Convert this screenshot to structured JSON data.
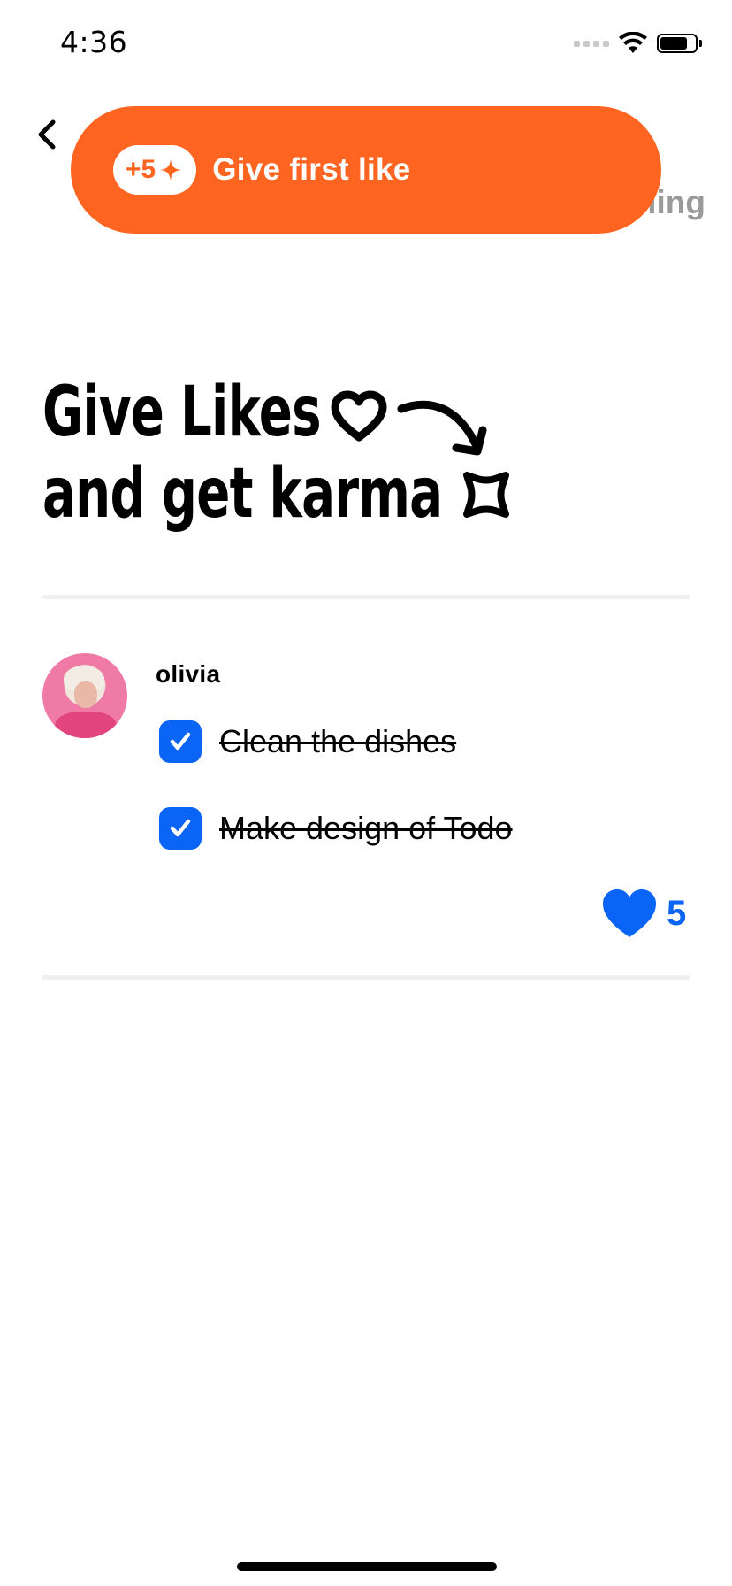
{
  "status_bar": {
    "time": "4:36"
  },
  "nav": {
    "back_icon": "chevron-left-icon",
    "faded_label": "ling"
  },
  "cta": {
    "karma_value": "+5",
    "karma_icon": "sparkle-icon",
    "label": "Give first like",
    "color": "#ff6420"
  },
  "headline": {
    "line1": "Give Likes",
    "line2": "and get karma"
  },
  "post": {
    "username": "olivia",
    "tasks": [
      {
        "label": "Clean the dishes",
        "done": true
      },
      {
        "label": "Make design of Todo",
        "done": true
      }
    ],
    "likes": {
      "count": "5",
      "icon": "heart-icon",
      "color": "#0a64f5"
    }
  }
}
